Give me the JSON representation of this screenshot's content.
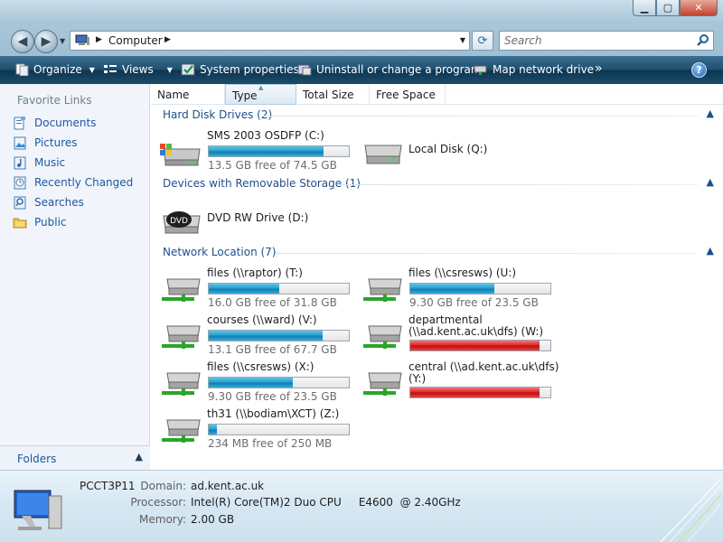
{
  "address": {
    "crumb": "Computer"
  },
  "search": {
    "placeholder": "Search"
  },
  "toolbar": {
    "organize": "Organize",
    "views": "Views",
    "system_properties": "System properties",
    "uninstall": "Uninstall or change a program",
    "map_drive": "Map network drive",
    "more": "»",
    "help": "?"
  },
  "sidebar": {
    "header": "Favorite Links",
    "items": [
      {
        "label": "Documents",
        "icon": "documents-icon"
      },
      {
        "label": "Pictures",
        "icon": "pictures-icon"
      },
      {
        "label": "Music",
        "icon": "music-icon"
      },
      {
        "label": "Recently Changed",
        "icon": "recently-changed-icon"
      },
      {
        "label": "Searches",
        "icon": "searches-icon"
      },
      {
        "label": "Public",
        "icon": "public-folder-icon"
      }
    ],
    "folders": "Folders"
  },
  "columns": [
    "Name",
    "Type",
    "Total Size",
    "Free Space"
  ],
  "groups": [
    {
      "title": "Hard Disk Drives (2)"
    },
    {
      "title": "Devices with Removable Storage (1)"
    },
    {
      "title": "Network Location (7)"
    }
  ],
  "drives": [
    {
      "name": "SMS 2003 OSDFP (C:)",
      "free": "13.5 GB free of 74.5 GB",
      "used_fraction": 0.82,
      "status": "normal"
    },
    {
      "name": "Local Disk (Q:)",
      "free": "",
      "used_fraction": null,
      "status": "none"
    },
    {
      "name": "DVD RW Drive (D:)",
      "free": "",
      "used_fraction": null,
      "status": "none"
    },
    {
      "name": "files (\\\\raptor) (T:)",
      "free": "16.0 GB free of 31.8 GB",
      "used_fraction": 0.5,
      "status": "normal"
    },
    {
      "name": "files (\\\\csresws) (U:)",
      "free": "9.30 GB free of 23.5 GB",
      "used_fraction": 0.6,
      "status": "normal"
    },
    {
      "name": "courses (\\\\ward) (V:)",
      "free": "13.1 GB free of 67.7 GB",
      "used_fraction": 0.81,
      "status": "normal"
    },
    {
      "name": "departmental",
      "name2": "(\\\\ad.kent.ac.uk\\dfs) (W:)",
      "free": "",
      "used_fraction": 0.92,
      "status": "full"
    },
    {
      "name": "files (\\\\csresws) (X:)",
      "free": "9.30 GB free of 23.5 GB",
      "used_fraction": 0.6,
      "status": "normal"
    },
    {
      "name": "central (\\\\ad.kent.ac.uk\\dfs)",
      "name2": "(Y:)",
      "free": "",
      "used_fraction": 0.92,
      "status": "full"
    },
    {
      "name": "th31 (\\\\bodiam\\XCT) (Z:)",
      "free": "234 MB free of 250 MB",
      "used_fraction": 0.06,
      "status": "normal"
    }
  ],
  "details": {
    "computer_name": "PCCT3P11",
    "domain_label": "Domain:",
    "domain": "ad.kent.ac.uk",
    "processor_label": "Processor:",
    "processor": "Intel(R) Core(TM)2 Duo CPU     E4600  @ 2.40GHz",
    "memory_label": "Memory:",
    "memory": "2.00 GB"
  },
  "colors": {
    "bar_normal": "#26a1cf",
    "bar_full": "#e02626",
    "group_text": "#1e4f8a",
    "link": "#1e56a0"
  }
}
